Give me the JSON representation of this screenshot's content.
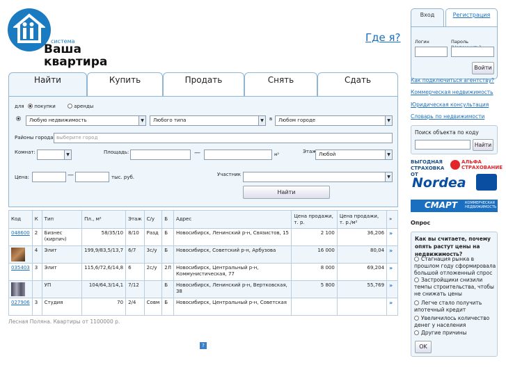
{
  "logo": {
    "system": "система",
    "line1": "Ваша",
    "line2": "квартира"
  },
  "header": {
    "where_link": "Где я?"
  },
  "login": {
    "tab_login": "Вход",
    "tab_register": "Регистрация",
    "login_label": "Логин",
    "password_label": "Пароль",
    "remind_link": "Напомнить",
    "enter_button": "Войти"
  },
  "right_links": [
    "Как подключиться агентству?",
    "Коммерческая недвижимость",
    "Юридическая консультация",
    "Словарь по недвижимости"
  ],
  "code_search": {
    "label": "Поиск объекта по коду",
    "button": "Найти"
  },
  "ads": {
    "alfa_text": "ВЫГОДНАЯ СТРАХОВКА ОТ",
    "alfa_name": "АЛЬФА СТРАХОВАНИЕ",
    "nordea": "Nordea",
    "smart": "СМАРТ",
    "smart_sub": "КОММЕРЧЕСКАЯ НЕДВИЖИМОСТЬ"
  },
  "poll": {
    "heading": "Опрос",
    "question": "Как вы считаете, почему опять растут цены на недвижимость?",
    "options": [
      "Стагнация рынка в прошлом году сформировала большой отложенный спрос",
      "Застройщики снизили темпы строительства, чтобы не снижать цены",
      "Легче стало получить ипотечный кредит",
      "Увеличилось количество денег у населения",
      "Другие причины"
    ],
    "ok_button": "OK"
  },
  "tabs": [
    "Найти",
    "Купить",
    "Продать",
    "Снять",
    "Сдать"
  ],
  "form": {
    "for_label": "для",
    "purchase": "покупки",
    "rent": "аренды",
    "property_select": "Любую недвижимость",
    "type_select": "Любого типа",
    "in_label": "в",
    "city_select": "Любом городе",
    "districts_label": "Районы города",
    "districts_placeholder": "выберите город",
    "rooms_label": "Комнат:",
    "area_label": "Площадь:",
    "dash": "—",
    "m2": "м²",
    "floor_label": "Этаж:",
    "floor_select": "Любой",
    "price_label": "Цена:",
    "price_unit": "тыс. руб.",
    "participant_label": "Участник",
    "find_button": "Найти"
  },
  "table": {
    "headers": [
      "Код",
      "К",
      "Тип",
      "Пл., м²",
      "Этаж",
      "С/у",
      "Б",
      "Адрес",
      "Цена продажи, т. р.",
      "Цена продажи, т. р./м²",
      "»"
    ],
    "rows": [
      {
        "code": "048600",
        "k": "2",
        "type": "Бизнес (кирпич)",
        "area": "58/35/10",
        "floor": "8/10",
        "su": "Разд",
        "b": "Б",
        "address": "Новосибирск, Ленинский р-н, Связистов, 15",
        "price": "2 100",
        "per_m2": "36,206"
      },
      {
        "code": "",
        "k": "4",
        "type": "Элит",
        "area": "199,9/83,5/13,7",
        "floor": "6/7",
        "su": "3с/у",
        "b": "Б",
        "address": "Новосибирск, Советский р-н, Арбузова",
        "price": "16 000",
        "per_m2": "80,04"
      },
      {
        "code": "035403",
        "k": "3",
        "type": "Элит",
        "area": "115,6/72,6/14,8",
        "floor": "6",
        "su": "2с/у",
        "b": "2Л",
        "address": "Новосибирск, Центральный р-н, Коммунистическая, 77",
        "price": "8 000",
        "per_m2": "69,204"
      },
      {
        "code": "",
        "k": "",
        "type": "УП",
        "area": "104/64,3/14,1",
        "floor": "7/12",
        "su": "",
        "b": "Б",
        "address": "Новосибирск, Ленинский р-н, Вертковская, 38",
        "price": "5 800",
        "per_m2": "55,769"
      },
      {
        "code": "027906",
        "k": "3",
        "type": "Студия",
        "area": "70",
        "floor": "2/4",
        "su": "Совм",
        "b": "Б",
        "address": "Новосибирск, Центральный р-н, Советская",
        "price": "",
        "per_m2": ""
      }
    ],
    "go": "»"
  },
  "footer": {
    "text": "Лесная Поляна. Квартиры от 1100000 р."
  }
}
